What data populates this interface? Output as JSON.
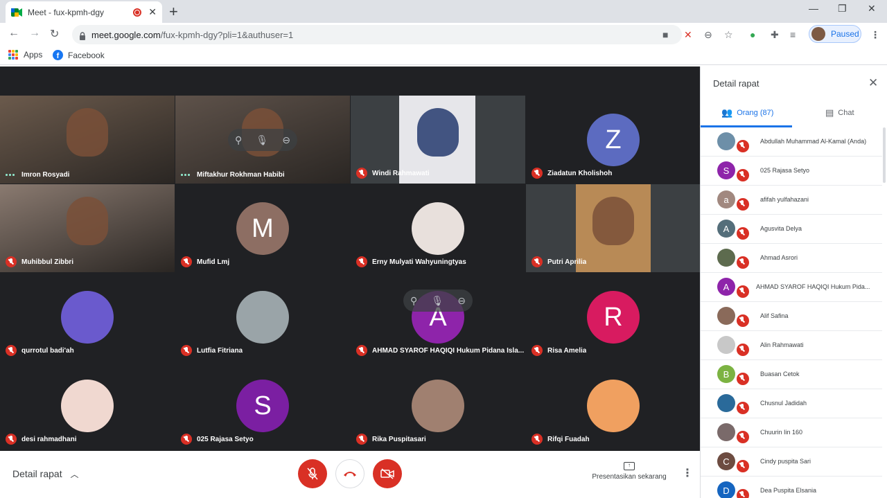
{
  "browser": {
    "tab_title": "Meet - fux-kpmh-dgy",
    "url_main": "meet.google.com",
    "url_rest": "/fux-kpmh-dgy?pli=1&authuser=1",
    "profile_status": "Paused",
    "bookmarks": [
      {
        "label": "Apps",
        "icon": "apps-grid-icon"
      },
      {
        "label": "Facebook",
        "icon": "facebook-icon"
      }
    ]
  },
  "participants_grid": [
    {
      "name": "Imron Rosyadi",
      "status": "speaking",
      "tile": "video",
      "bg": "#6b5a4c"
    },
    {
      "name": "Miftakhur Rokhman Habibi",
      "status": "speaking",
      "tile": "video",
      "bg": "#5e524a"
    },
    {
      "name": "Windi Rahmawati",
      "status": "muted",
      "tile": "video",
      "bg": "#e6e6ea"
    },
    {
      "name": "Ziadatun Kholishoh",
      "status": "muted",
      "tile": "avatar",
      "initial": "Z",
      "color": "#5c6bc0"
    },
    {
      "name": "Muhibbul Zibbri",
      "status": "muted",
      "tile": "video",
      "bg": "#8a7a70"
    },
    {
      "name": "Mufid Lmj",
      "status": "muted",
      "tile": "avatar",
      "initial": "M",
      "color": "#8d6e63"
    },
    {
      "name": "Erny Mulyati Wahyuningtyas",
      "status": "muted",
      "tile": "photo",
      "color": "#e8e0dc"
    },
    {
      "name": "Putri Aprilia",
      "status": "muted",
      "tile": "video",
      "bg": "#b88a56"
    },
    {
      "name": "qurrotul badi'ah",
      "status": "muted",
      "tile": "photo",
      "color": "#6a5acd"
    },
    {
      "name": "Lutfia Fitriana",
      "status": "muted",
      "tile": "photo",
      "color": "#9aa4a8"
    },
    {
      "name": "AHMAD SYAROF HAQIQI Hukum Pidana Isla...",
      "status": "muted",
      "tile": "avatar",
      "initial": "A",
      "color": "#8e24aa"
    },
    {
      "name": "Risa Amelia",
      "status": "muted",
      "tile": "avatar",
      "initial": "R",
      "color": "#d81b60"
    },
    {
      "name": "desi rahmadhani",
      "status": "muted",
      "tile": "photo",
      "color": "#f0d8d0"
    },
    {
      "name": "025 Rajasa Setyo",
      "status": "muted",
      "tile": "avatar",
      "initial": "S",
      "color": "#7b1fa2"
    },
    {
      "name": "Rika Puspitasari",
      "status": "muted",
      "tile": "photo",
      "color": "#a08070"
    },
    {
      "name": "Rifqi Fuadah",
      "status": "muted",
      "tile": "photo",
      "color": "#f0a060"
    }
  ],
  "bottom_bar": {
    "detail_label": "Detail rapat",
    "present_label": "Presentasikan sekarang",
    "mic_color": "#d93025",
    "cam_color": "#d93025"
  },
  "side_panel": {
    "title": "Detail rapat",
    "tab_people": "Orang (87)",
    "tab_chat": "Chat",
    "people": [
      {
        "name": "Abdullah Muhammad Al-Kamal (Anda)",
        "initial": "",
        "color": "#6d8fa8"
      },
      {
        "name": "025 Rajasa Setyo",
        "initial": "S",
        "color": "#8e24aa"
      },
      {
        "name": "afifah yulfahazani",
        "initial": "a",
        "color": "#a1887f"
      },
      {
        "name": "Agusvita Delya",
        "initial": "A",
        "color": "#546e7a"
      },
      {
        "name": "Ahmad Asrori",
        "initial": "",
        "color": "#5d6b4e"
      },
      {
        "name": "AHMAD SYAROF HAQIQI Hukum Pida...",
        "initial": "A",
        "color": "#8e24aa"
      },
      {
        "name": "Alif Safina",
        "initial": "",
        "color": "#8a6a5a"
      },
      {
        "name": "Alin Rahmawati",
        "initial": "",
        "color": "#c8c8c8"
      },
      {
        "name": "Buasan Cetok",
        "initial": "B",
        "color": "#7cb342"
      },
      {
        "name": "Chusnul Jadidah",
        "initial": "",
        "color": "#2a6a9a"
      },
      {
        "name": "Chuurin Iin 160",
        "initial": "",
        "color": "#7a6a6a"
      },
      {
        "name": "Cindy puspita Sari",
        "initial": "C",
        "color": "#6d4c41"
      },
      {
        "name": "Dea Puspita Elsania",
        "initial": "D",
        "color": "#1565c0"
      }
    ]
  }
}
